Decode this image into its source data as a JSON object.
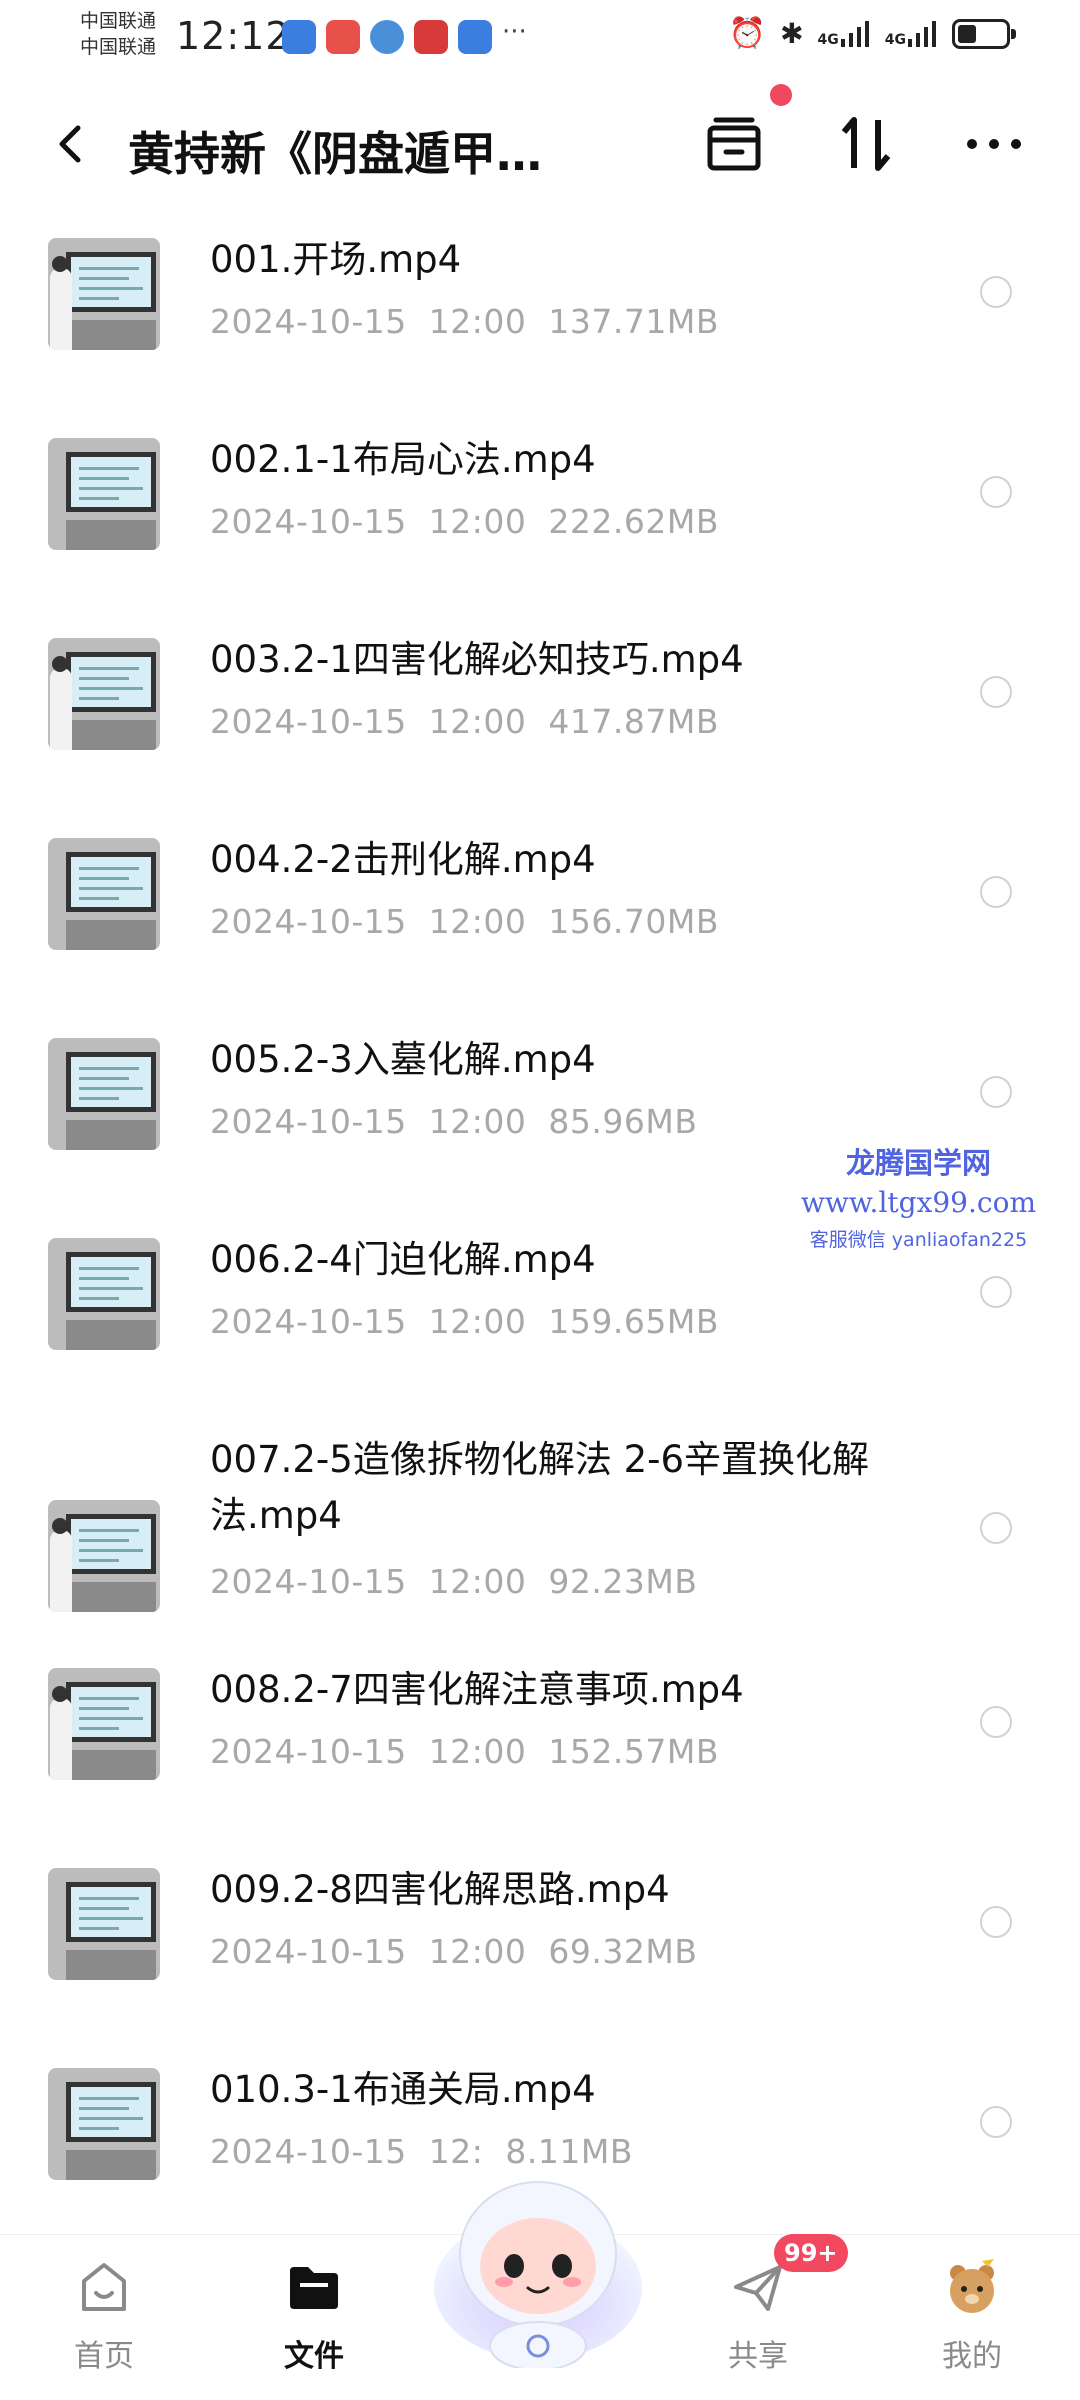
{
  "status_bar": {
    "carrier_1": "中国联通",
    "carrier_2": "中国联通",
    "time": "12:12",
    "more": "···",
    "network_1": "4G",
    "network_2": "4G",
    "battery_level": 0.4
  },
  "header": {
    "title": "黄持新《阴盘遁甲…"
  },
  "files": [
    {
      "name": "001.开场.mp4",
      "date": "2024-10-15",
      "time": "12:00",
      "size": "137.71MB"
    },
    {
      "name": "002.1-1布局心法.mp4",
      "date": "2024-10-15",
      "time": "12:00",
      "size": "222.62MB"
    },
    {
      "name": "003.2-1四害化解必知技巧.mp4",
      "date": "2024-10-15",
      "time": "12:00",
      "size": "417.87MB"
    },
    {
      "name": "004.2-2击刑化解.mp4",
      "date": "2024-10-15",
      "time": "12:00",
      "size": "156.70MB"
    },
    {
      "name": "005.2-3入墓化解.mp4",
      "date": "2024-10-15",
      "time": "12:00",
      "size": "85.96MB"
    },
    {
      "name": "006.2-4门迫化解.mp4",
      "date": "2024-10-15",
      "time": "12:00",
      "size": "159.65MB"
    },
    {
      "name": "007.2-5造像拆物化解法 2-6辛置换化解法.mp4",
      "date": "2024-10-15",
      "time": "12:00",
      "size": "92.23MB"
    },
    {
      "name": "008.2-7四害化解注意事项.mp4",
      "date": "2024-10-15",
      "time": "12:00",
      "size": "152.57MB"
    },
    {
      "name": "009.2-8四害化解思路.mp4",
      "date": "2024-10-15",
      "time": "12:00",
      "size": "69.32MB"
    },
    {
      "name": "010.3-1布通关局.mp4",
      "date": "2024-10-15",
      "time": "12:",
      "size": "8.11MB"
    }
  ],
  "watermark": {
    "line1": "龙腾国学网",
    "line2": "www.ltgx99.com",
    "line3": "客服微信 yanliaofan225"
  },
  "nav": {
    "home": "首页",
    "files": "文件",
    "share": "共享",
    "share_badge": "99+",
    "mine": "我的"
  },
  "colors": {
    "accent_red": "#f24860",
    "meta_gray": "#a8a8a8",
    "watermark_blue": "#5064e0"
  }
}
